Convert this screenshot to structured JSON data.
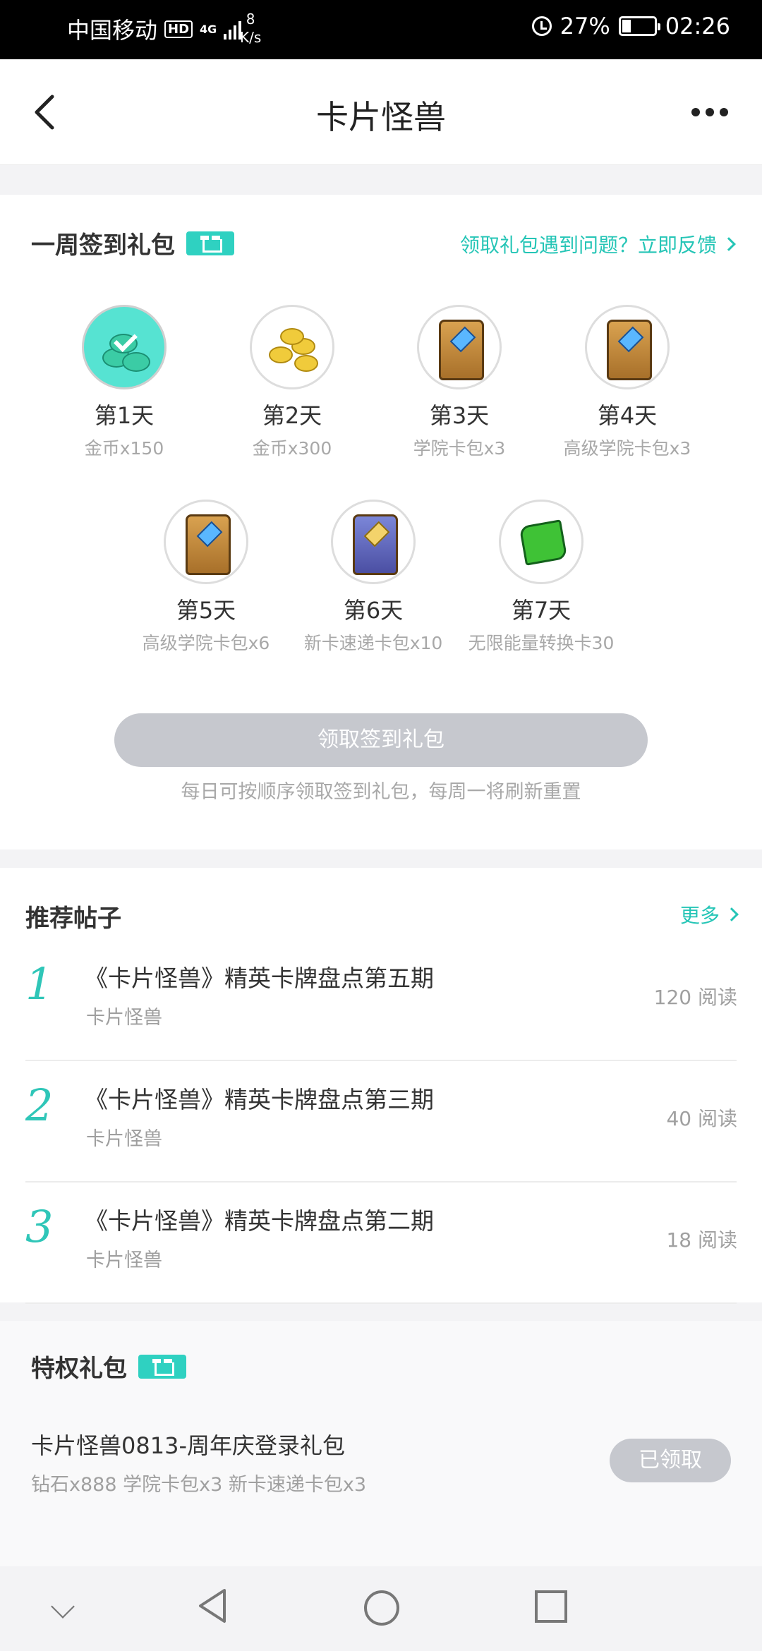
{
  "status_bar": {
    "carrier": "中国移动",
    "hd": "HD",
    "network": "4G",
    "speed_value": "8",
    "speed_unit": "K/s",
    "battery": "27%",
    "time": "02:26"
  },
  "header": {
    "title": "卡片怪兽"
  },
  "signin": {
    "heading": "一周签到礼包",
    "feedback_link": "领取礼包遇到问题？立即反馈",
    "days": [
      {
        "label": "第1天",
        "reward": "金币x150",
        "icon": "coins-claimed-icon",
        "claimed": true
      },
      {
        "label": "第2天",
        "reward": "金币x300",
        "icon": "gold-coins-icon",
        "claimed": false
      },
      {
        "label": "第3天",
        "reward": "学院卡包x3",
        "icon": "card-pack-icon",
        "claimed": false
      },
      {
        "label": "第4天",
        "reward": "高级学院卡包x3",
        "icon": "card-pack-icon",
        "claimed": false
      },
      {
        "label": "第5天",
        "reward": "高级学院卡包x6",
        "icon": "card-pack-icon",
        "claimed": false
      },
      {
        "label": "第6天",
        "reward": "新卡速递卡包x10",
        "icon": "blue-card-pack-icon",
        "claimed": false
      },
      {
        "label": "第7天",
        "reward": "无限能量转换卡30",
        "icon": "green-gem-icon",
        "claimed": false
      }
    ],
    "claim_button": "领取签到礼包",
    "note": "每日可按顺序领取签到礼包，每周一将刷新重置"
  },
  "recommended": {
    "heading": "推荐帖子",
    "more_link": "更多",
    "posts": [
      {
        "rank": "1",
        "title": "《卡片怪兽》精英卡牌盘点第五期",
        "game": "卡片怪兽",
        "reads": "120 阅读"
      },
      {
        "rank": "2",
        "title": "《卡片怪兽》精英卡牌盘点第三期",
        "game": "卡片怪兽",
        "reads": "40 阅读"
      },
      {
        "rank": "3",
        "title": "《卡片怪兽》精英卡牌盘点第二期",
        "game": "卡片怪兽",
        "reads": "18 阅读"
      }
    ]
  },
  "privilege": {
    "heading": "特权礼包",
    "gift_title": "卡片怪兽0813-周年庆登录礼包",
    "gift_items": "钻石x888 学院卡包x3 新卡速递卡包x3",
    "button": "已领取"
  },
  "colors": {
    "accent": "#2fd1c1",
    "disabled": "#c6c8ce"
  }
}
